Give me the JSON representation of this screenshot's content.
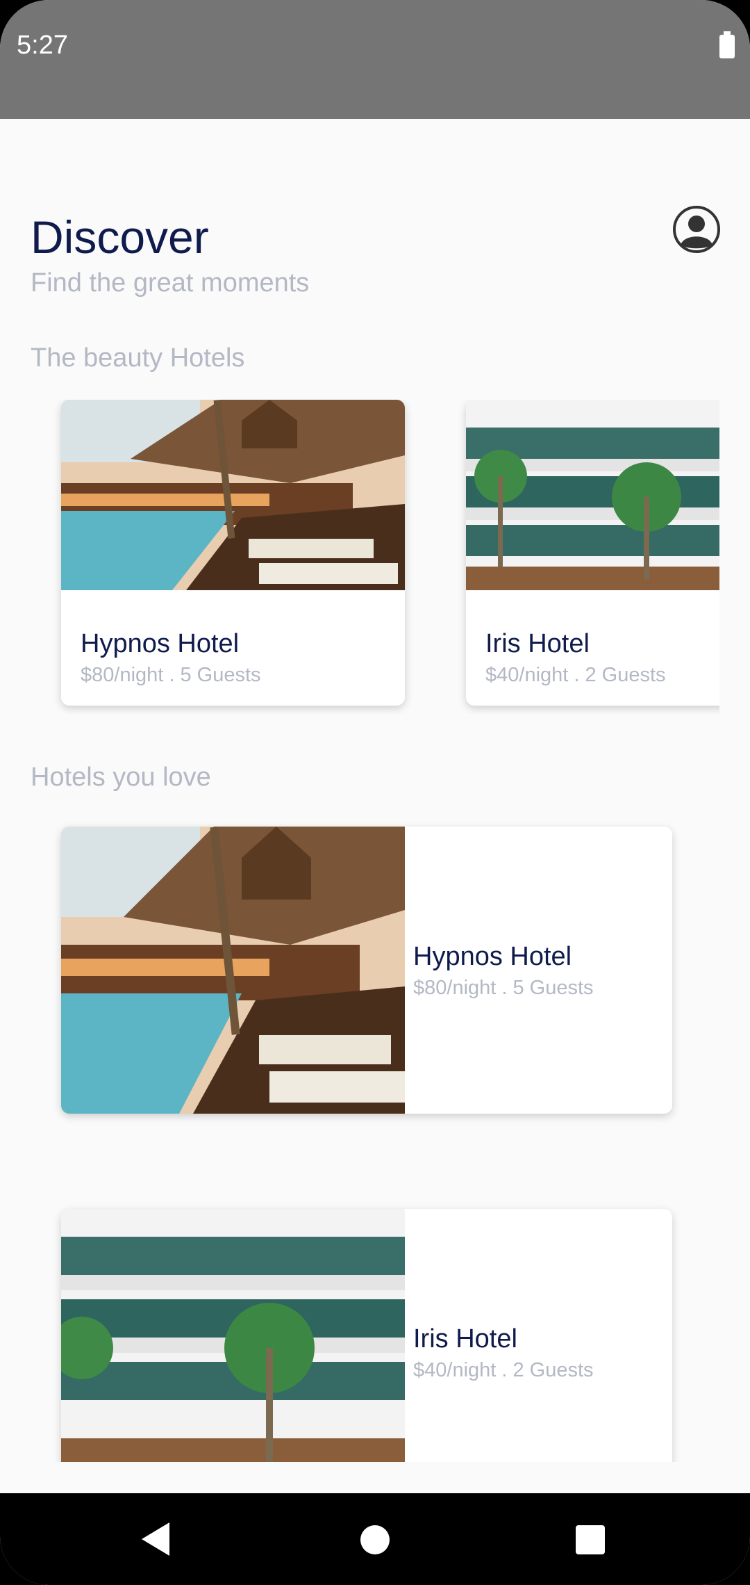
{
  "status_bar": {
    "time": "5:27"
  },
  "header": {
    "title": "Discover",
    "subtitle": "Find the great moments",
    "profile_icon": "account-circle-icon"
  },
  "sections": {
    "beauty": {
      "title": "The beauty Hotels",
      "items": [
        {
          "name": "Hypnos Hotel",
          "info": "$80/night . 5 Guests"
        },
        {
          "name": "Iris Hotel",
          "info": "$40/night . 2 Guests"
        }
      ]
    },
    "love": {
      "title": "Hotels you love",
      "items": [
        {
          "name": "Hypnos Hotel",
          "info": "$80/night . 5 Guests"
        },
        {
          "name": "Iris Hotel",
          "info": "$40/night . 2 Guests"
        }
      ]
    }
  },
  "nav": {
    "back_icon": "back-triangle-icon",
    "home_icon": "home-circle-icon",
    "recents_icon": "recents-square-icon"
  }
}
